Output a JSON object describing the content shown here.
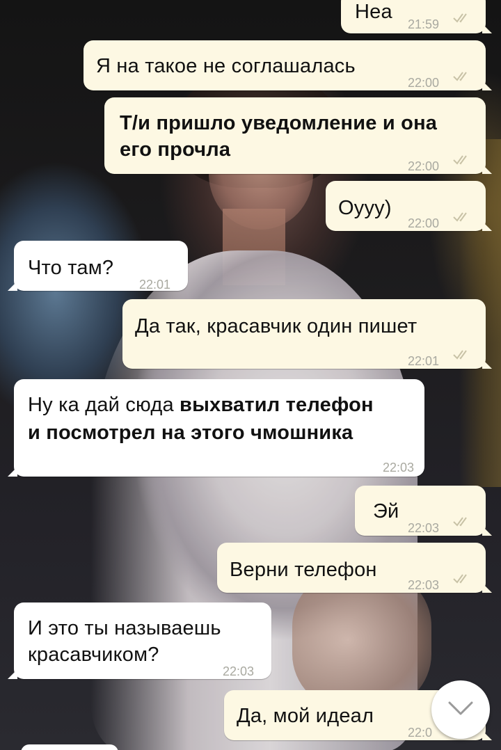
{
  "messages": [
    {
      "direction": "out",
      "text": "Неа",
      "time": "21:59",
      "read": true
    },
    {
      "direction": "out",
      "text": "Я на такое не соглашалась",
      "time": "22:00",
      "read": true
    },
    {
      "direction": "out",
      "line1": "Т/и пришло уведомление и она",
      "line2": "его прочла",
      "time": "22:00",
      "read": true
    },
    {
      "direction": "out",
      "text": "Оууу)",
      "time": "22:00",
      "read": true
    },
    {
      "direction": "in",
      "text": "Что там?",
      "time": "22:01"
    },
    {
      "direction": "out",
      "text": "Да так, красавчик один пишет",
      "time": "22:01",
      "read": true
    },
    {
      "direction": "in",
      "line1_plain": "Ну ка дай сюда ",
      "line1_bold": "выхватил телефон",
      "line2_bold": "и посмотрел на этого чмошника",
      "time": "22:03"
    },
    {
      "direction": "out",
      "text": "Эй",
      "time": "22:03",
      "read": true
    },
    {
      "direction": "out",
      "text": "Верни телефон",
      "time": "22:03",
      "read": true
    },
    {
      "direction": "in",
      "line1": "И это ты называешь",
      "line2": "красавчиком?",
      "time": "22:03"
    },
    {
      "direction": "out",
      "text": "Да, мой идеал",
      "time": "22:0",
      "read": true
    }
  ],
  "icons": {
    "read_receipt": "double-check-icon",
    "scroll_down": "chevron-down-icon"
  },
  "colors": {
    "outgoing_bubble": "#fdf8e3",
    "incoming_bubble": "#ffffff",
    "timestamp": "#a9a9a0",
    "check": "#c8c2a6"
  }
}
